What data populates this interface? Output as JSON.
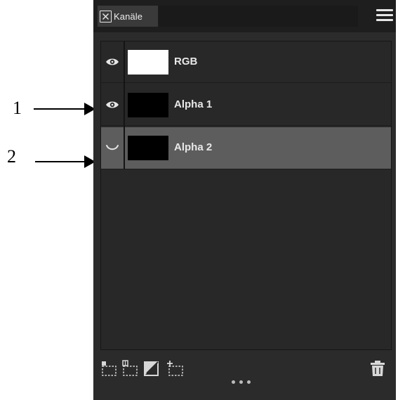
{
  "annotations": [
    {
      "number": "1"
    },
    {
      "number": "2"
    }
  ],
  "panel": {
    "tab_label": "Kanäle",
    "tab_close_icon": "close-box-icon",
    "menu_icon": "hamburger-menu-icon",
    "channels": [
      {
        "label": "RGB",
        "visibility_icon": "eye-icon",
        "thumbnail": "white",
        "selected": false
      },
      {
        "label": "Alpha 1",
        "visibility_icon": "eye-icon",
        "thumbnail": "black",
        "selected": false
      },
      {
        "label": "Alpha 2",
        "visibility_icon": "eye-closed-icon",
        "thumbnail": "black",
        "selected": true
      }
    ],
    "footer_icons": [
      "load-channel-as-selection-icon",
      "save-selection-as-channel-icon",
      "channel-mixer-icon",
      "new-channel-icon",
      "trash-icon"
    ]
  },
  "colors": {
    "panel_bg": "#2b2b2b",
    "selected_row": "#5d5d5d",
    "text": "#e8e8e8"
  }
}
